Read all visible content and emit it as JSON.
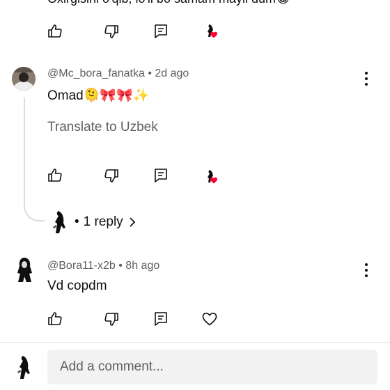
{
  "top_comment": {
    "cut_text": "Oxirgisini o'qib, lo'li bo samam mayli dum😂"
  },
  "comments": [
    {
      "author": "@Mc_bora_fanatka",
      "time": "2d ago",
      "text": "Omad🫠🎀🎀✨",
      "translate_label": "Translate to Uzbek",
      "replies_label": "1 reply"
    },
    {
      "author": "@Bora11-x2b",
      "time": "8h ago",
      "text": "Vd copdm"
    }
  ],
  "separator": "•",
  "composer": {
    "placeholder": "Add a comment..."
  },
  "colors": {
    "heart_red": "#ff0033",
    "text_primary": "#0f0f0f",
    "text_secondary": "#606060"
  }
}
